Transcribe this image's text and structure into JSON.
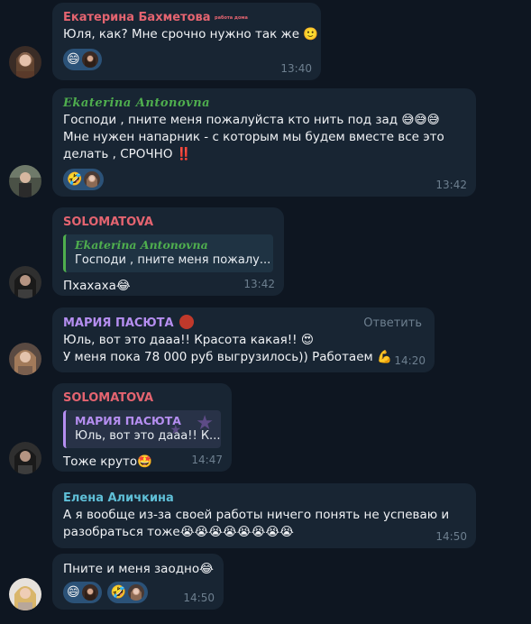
{
  "messages": [
    {
      "sender": "Екатерина Бахметова",
      "sender_color": "#e46470",
      "badge": "работа дома",
      "text": [
        "Юля, как? Мне срочно нужно так же 🙂"
      ],
      "reactions": [
        "😄"
      ],
      "time": "13:40"
    },
    {
      "sender": "Ekaterina Antonovna",
      "sender_color": "#4fae4e",
      "text": [
        "Господи , пните меня пожалуйста кто нить под зад 😅😅😅",
        "Мне нужен напарник - с которым мы будем вместе все это",
        "делать , СРОЧНО ‼️"
      ],
      "reactions": [
        "🤣"
      ],
      "time": "13:42"
    },
    {
      "sender": "SOLOMATOVA",
      "sender_color": "#e46470",
      "quote_sender": "Ekaterina Antonovna",
      "quote_text": "Господи , пните меня пожалу...",
      "text": [
        "Пхахаха😂"
      ],
      "time": "13:42"
    },
    {
      "sender": "МАРИЯ ПАСЮТА",
      "sender_color": "#b58ef0",
      "reply_label": "Ответить",
      "text": [
        "Юль, вот это дааа!! Красота какая!! 😍",
        "У меня пока 78 000 руб выгрузилось)) Работаем 💪"
      ],
      "time": "14:20"
    },
    {
      "sender": "SOLOMATOVA",
      "sender_color": "#e46470",
      "quote_sender": "МАРИЯ ПАСЮТА",
      "quote_text": "Юль, вот это дааа!! К...",
      "text": [
        "Тоже круто🤩"
      ],
      "time": "14:47"
    },
    {
      "sender": "Елена Аличкина",
      "sender_color": "#5fbfd7",
      "text": [
        "А я вообще из-за своей работы ничего понять не успеваю и",
        "разобраться тоже😭😭😭😭😭😭😭😭"
      ],
      "time": "14:50"
    },
    {
      "text": [
        "Пните и меня заодно😂"
      ],
      "reactions": [
        "😄",
        "🤣"
      ],
      "time": "14:50"
    }
  ],
  "colors": {
    "background": "#0e1621",
    "bubble": "#182533",
    "reaction": "#2b5278",
    "time": "#6d7f8f"
  }
}
